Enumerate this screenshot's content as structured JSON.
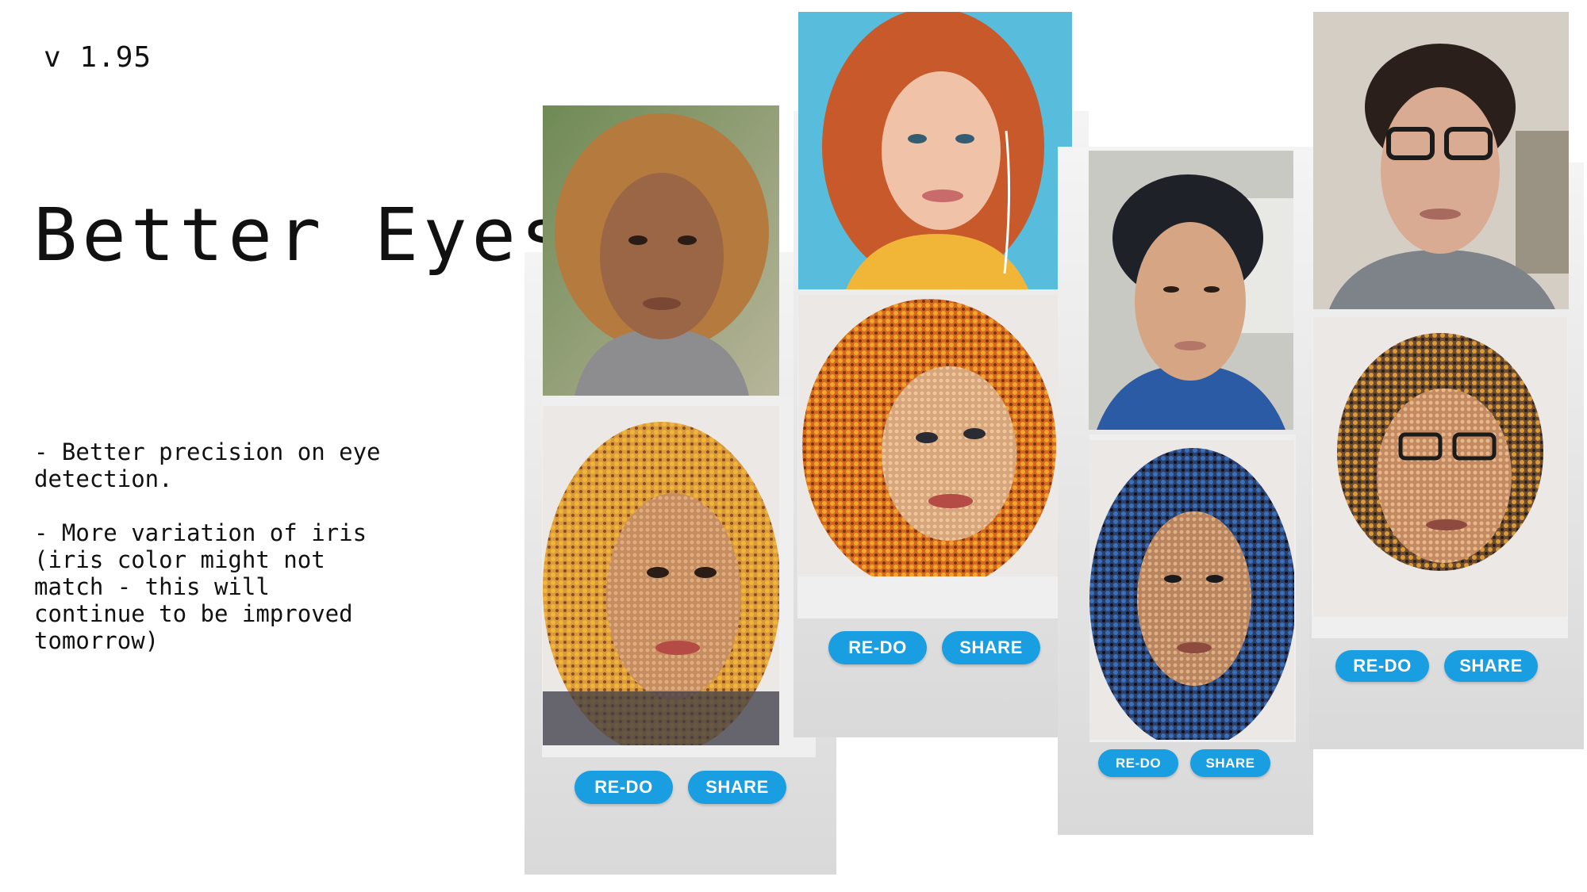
{
  "slide": {
    "version": "v 1.95",
    "title": "Better Eyes",
    "notes": "- Better precision on eye\ndetection.\n\n- More variation of iris\n(iris color might not\nmatch - this will\ncontinue to be improved\ntomorrow)"
  },
  "panels": [
    {
      "redo": "RE-DO",
      "share": "SHARE",
      "photo": "portrait-curly-hair-woman",
      "mosaic": "emoji-mosaic-curly-hair-woman"
    },
    {
      "redo": "RE-DO",
      "share": "SHARE",
      "photo": "portrait-red-hair-woman",
      "mosaic": "emoji-mosaic-red-hair-woman"
    },
    {
      "redo": "RE-DO",
      "share": "SHARE",
      "photo": "portrait-young-man",
      "mosaic": "emoji-mosaic-young-man"
    },
    {
      "redo": "RE-DO",
      "share": "SHARE",
      "photo": "portrait-man-glasses",
      "mosaic": "emoji-mosaic-man-glasses"
    }
  ],
  "colors": {
    "button": "#1a9ee2",
    "panel": "#dcdcdc"
  }
}
